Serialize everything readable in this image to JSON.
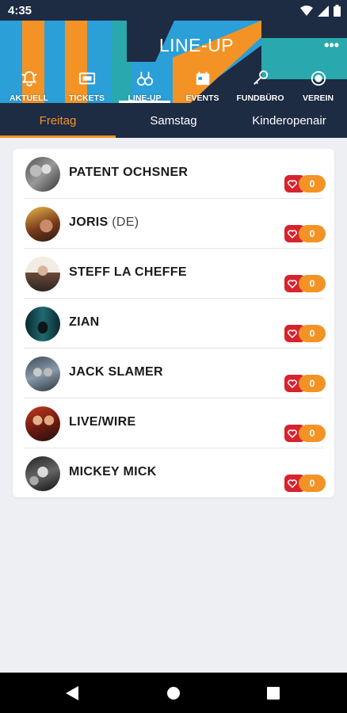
{
  "status_bar": {
    "time": "4:35"
  },
  "header": {
    "title": "LINE-UP",
    "more_label": "•••",
    "nav": [
      {
        "label": "AKTUELL",
        "icon": "bell-icon"
      },
      {
        "label": "TICKETS",
        "icon": "ticket-icon"
      },
      {
        "label": "LINE-UP",
        "icon": "guitar-icon",
        "active": true
      },
      {
        "label": "EVENTS",
        "icon": "calendar-icon"
      },
      {
        "label": "FUNDBÜRO",
        "icon": "key-icon"
      },
      {
        "label": "VEREIN",
        "icon": "circle-icon"
      }
    ]
  },
  "tabs": [
    {
      "label": "Freitag",
      "active": true
    },
    {
      "label": "Samstag"
    },
    {
      "label": "Kinderopenair"
    }
  ],
  "artists": [
    {
      "name": "PATENT OCHSNER",
      "suffix": "",
      "likes": "0"
    },
    {
      "name": "JORIS",
      "suffix": " (DE)",
      "likes": "0"
    },
    {
      "name": "STEFF LA CHEFFE",
      "suffix": "",
      "likes": "0"
    },
    {
      "name": "ZIAN",
      "suffix": "",
      "likes": "0"
    },
    {
      "name": "JACK SLAMER",
      "suffix": "",
      "likes": "0"
    },
    {
      "name": "LIVE/WIRE",
      "suffix": "",
      "likes": "0"
    },
    {
      "name": "MICKEY MICK",
      "suffix": "",
      "likes": "0"
    }
  ],
  "colors": {
    "navy": "#1d2b43",
    "orange": "#f39325",
    "blue": "#2a9fd8",
    "teal": "#29a9ad",
    "heart_red": "#d7232e"
  }
}
